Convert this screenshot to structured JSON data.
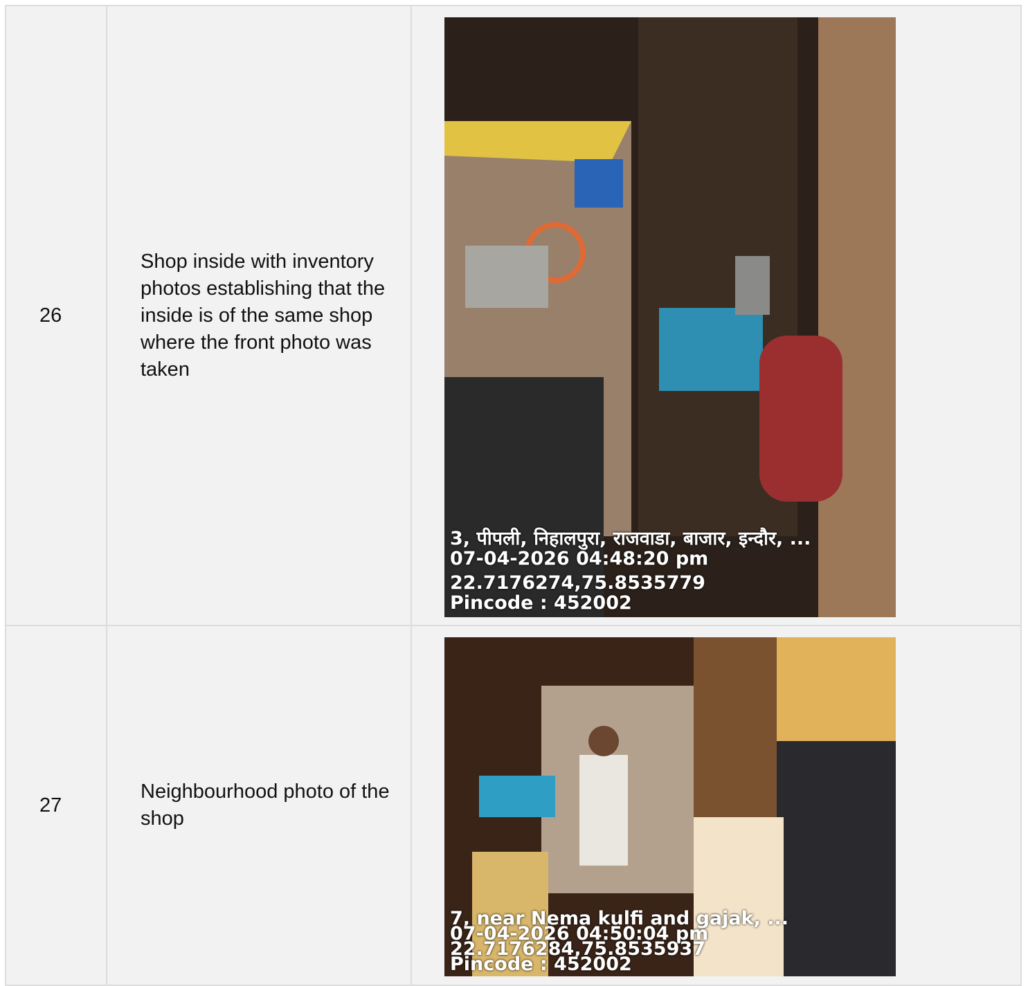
{
  "rows": [
    {
      "number": "26",
      "description": "Shop inside with inventory photos establishing that the inside is of the same shop where the front photo was taken",
      "photo": {
        "address": "3, पीपली, निहालपुरा, राजवाडा, बाजार, इन्दौर, ...",
        "timestamp": "07-04-2026 04:48:20 pm",
        "coords": "22.7176274,75.8535779",
        "pincode": "Pincode : 452002"
      }
    },
    {
      "number": "27",
      "description": "Neighbourhood photo of the shop",
      "photo": {
        "address": "7, near Nema kulfi and gajak, ...",
        "timestamp": "07-04-2026 04:50:04 pm",
        "coords": "22.7176284,75.8535937",
        "pincode": "Pincode : 452002"
      }
    }
  ]
}
